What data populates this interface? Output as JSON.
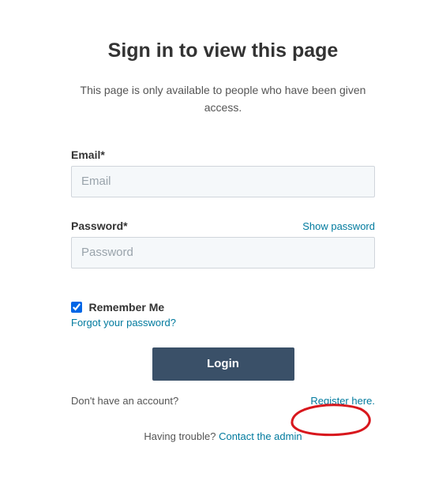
{
  "title": "Sign in to view this page",
  "subtitle": "This page is only available to people who have been given access.",
  "email": {
    "label": "Email*",
    "placeholder": "Email"
  },
  "password": {
    "label": "Password*",
    "placeholder": "Password",
    "toggle": "Show password"
  },
  "remember": {
    "label": "Remember Me",
    "checked": true
  },
  "links": {
    "forgot": "Forgot your password?",
    "register_prompt": "Don't have an account?",
    "register": "Register here.",
    "trouble_prompt": "Having trouble? ",
    "contact": "Contact the admin"
  },
  "login_button": "Login"
}
